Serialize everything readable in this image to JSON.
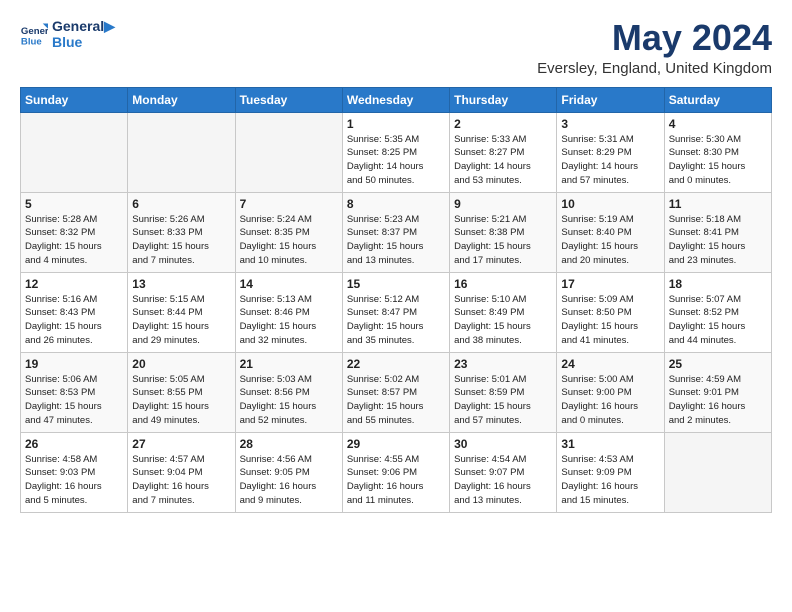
{
  "header": {
    "logo_line1": "General",
    "logo_line2": "Blue",
    "title": "May 2024",
    "location": "Eversley, England, United Kingdom"
  },
  "days_of_week": [
    "Sunday",
    "Monday",
    "Tuesday",
    "Wednesday",
    "Thursday",
    "Friday",
    "Saturday"
  ],
  "weeks": [
    [
      {
        "day": "",
        "info": ""
      },
      {
        "day": "",
        "info": ""
      },
      {
        "day": "",
        "info": ""
      },
      {
        "day": "1",
        "info": "Sunrise: 5:35 AM\nSunset: 8:25 PM\nDaylight: 14 hours\nand 50 minutes."
      },
      {
        "day": "2",
        "info": "Sunrise: 5:33 AM\nSunset: 8:27 PM\nDaylight: 14 hours\nand 53 minutes."
      },
      {
        "day": "3",
        "info": "Sunrise: 5:31 AM\nSunset: 8:29 PM\nDaylight: 14 hours\nand 57 minutes."
      },
      {
        "day": "4",
        "info": "Sunrise: 5:30 AM\nSunset: 8:30 PM\nDaylight: 15 hours\nand 0 minutes."
      }
    ],
    [
      {
        "day": "5",
        "info": "Sunrise: 5:28 AM\nSunset: 8:32 PM\nDaylight: 15 hours\nand 4 minutes."
      },
      {
        "day": "6",
        "info": "Sunrise: 5:26 AM\nSunset: 8:33 PM\nDaylight: 15 hours\nand 7 minutes."
      },
      {
        "day": "7",
        "info": "Sunrise: 5:24 AM\nSunset: 8:35 PM\nDaylight: 15 hours\nand 10 minutes."
      },
      {
        "day": "8",
        "info": "Sunrise: 5:23 AM\nSunset: 8:37 PM\nDaylight: 15 hours\nand 13 minutes."
      },
      {
        "day": "9",
        "info": "Sunrise: 5:21 AM\nSunset: 8:38 PM\nDaylight: 15 hours\nand 17 minutes."
      },
      {
        "day": "10",
        "info": "Sunrise: 5:19 AM\nSunset: 8:40 PM\nDaylight: 15 hours\nand 20 minutes."
      },
      {
        "day": "11",
        "info": "Sunrise: 5:18 AM\nSunset: 8:41 PM\nDaylight: 15 hours\nand 23 minutes."
      }
    ],
    [
      {
        "day": "12",
        "info": "Sunrise: 5:16 AM\nSunset: 8:43 PM\nDaylight: 15 hours\nand 26 minutes."
      },
      {
        "day": "13",
        "info": "Sunrise: 5:15 AM\nSunset: 8:44 PM\nDaylight: 15 hours\nand 29 minutes."
      },
      {
        "day": "14",
        "info": "Sunrise: 5:13 AM\nSunset: 8:46 PM\nDaylight: 15 hours\nand 32 minutes."
      },
      {
        "day": "15",
        "info": "Sunrise: 5:12 AM\nSunset: 8:47 PM\nDaylight: 15 hours\nand 35 minutes."
      },
      {
        "day": "16",
        "info": "Sunrise: 5:10 AM\nSunset: 8:49 PM\nDaylight: 15 hours\nand 38 minutes."
      },
      {
        "day": "17",
        "info": "Sunrise: 5:09 AM\nSunset: 8:50 PM\nDaylight: 15 hours\nand 41 minutes."
      },
      {
        "day": "18",
        "info": "Sunrise: 5:07 AM\nSunset: 8:52 PM\nDaylight: 15 hours\nand 44 minutes."
      }
    ],
    [
      {
        "day": "19",
        "info": "Sunrise: 5:06 AM\nSunset: 8:53 PM\nDaylight: 15 hours\nand 47 minutes."
      },
      {
        "day": "20",
        "info": "Sunrise: 5:05 AM\nSunset: 8:55 PM\nDaylight: 15 hours\nand 49 minutes."
      },
      {
        "day": "21",
        "info": "Sunrise: 5:03 AM\nSunset: 8:56 PM\nDaylight: 15 hours\nand 52 minutes."
      },
      {
        "day": "22",
        "info": "Sunrise: 5:02 AM\nSunset: 8:57 PM\nDaylight: 15 hours\nand 55 minutes."
      },
      {
        "day": "23",
        "info": "Sunrise: 5:01 AM\nSunset: 8:59 PM\nDaylight: 15 hours\nand 57 minutes."
      },
      {
        "day": "24",
        "info": "Sunrise: 5:00 AM\nSunset: 9:00 PM\nDaylight: 16 hours\nand 0 minutes."
      },
      {
        "day": "25",
        "info": "Sunrise: 4:59 AM\nSunset: 9:01 PM\nDaylight: 16 hours\nand 2 minutes."
      }
    ],
    [
      {
        "day": "26",
        "info": "Sunrise: 4:58 AM\nSunset: 9:03 PM\nDaylight: 16 hours\nand 5 minutes."
      },
      {
        "day": "27",
        "info": "Sunrise: 4:57 AM\nSunset: 9:04 PM\nDaylight: 16 hours\nand 7 minutes."
      },
      {
        "day": "28",
        "info": "Sunrise: 4:56 AM\nSunset: 9:05 PM\nDaylight: 16 hours\nand 9 minutes."
      },
      {
        "day": "29",
        "info": "Sunrise: 4:55 AM\nSunset: 9:06 PM\nDaylight: 16 hours\nand 11 minutes."
      },
      {
        "day": "30",
        "info": "Sunrise: 4:54 AM\nSunset: 9:07 PM\nDaylight: 16 hours\nand 13 minutes."
      },
      {
        "day": "31",
        "info": "Sunrise: 4:53 AM\nSunset: 9:09 PM\nDaylight: 16 hours\nand 15 minutes."
      },
      {
        "day": "",
        "info": ""
      }
    ]
  ]
}
